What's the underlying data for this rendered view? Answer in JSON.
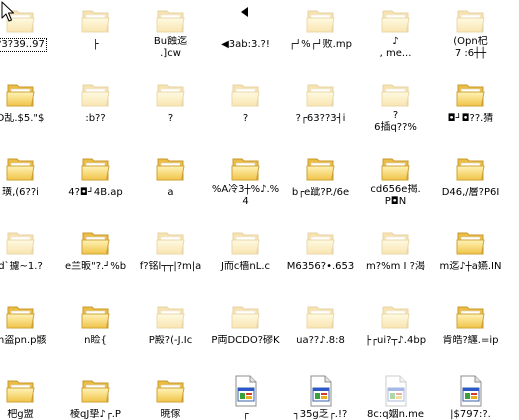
{
  "colors": {
    "background": "#ffffff",
    "label_text": "#000000"
  },
  "cursor": {
    "icon": "arrow-cursor"
  },
  "items": [
    {
      "label": "?3?39..97",
      "icon": "folder",
      "hidden": true,
      "focused": true
    },
    {
      "label": "├",
      "icon": "folder",
      "hidden": true
    },
    {
      "label": "Bu蝕迄\n.]cw",
      "icon": "folder",
      "hidden": true
    },
    {
      "label": "◀3ab:3.?!",
      "icon": "triangle",
      "hidden": false
    },
    {
      "label": "┌┘%┌┘败.mp",
      "icon": "folder",
      "hidden": true
    },
    {
      "label": "♪\n, me...",
      "icon": "folder",
      "hidden": true
    },
    {
      "label": "(Opn杞\n7 :6┼┼",
      "icon": "folder",
      "hidden": true
    },
    {
      "label": "D乱.$5.\"$",
      "icon": "folder",
      "hidden": false
    },
    {
      "label": ":b??",
      "icon": "folder",
      "hidden": true
    },
    {
      "label": "?",
      "icon": "folder",
      "hidden": true
    },
    {
      "label": "?",
      "icon": "folder",
      "hidden": true
    },
    {
      "label": "?┌63??3┤i",
      "icon": "folder",
      "hidden": true
    },
    {
      "label": "?\n6插q??%",
      "icon": "folder",
      "hidden": true
    },
    {
      "label": "◘┘◘??.猜",
      "icon": "folder",
      "hidden": false
    },
    {
      "label": "璜,(6??i",
      "icon": "folder",
      "hidden": false
    },
    {
      "label": "4?◘┘4B.ap",
      "icon": "folder",
      "hidden": false
    },
    {
      "label": "a",
      "icon": "folder",
      "hidden": false
    },
    {
      "label": "%A冷3┼%♪.%4",
      "icon": "folder",
      "hidden": false
    },
    {
      "label": "b┌e跐?P./6e",
      "icon": "folder",
      "hidden": false
    },
    {
      "label": "cd656e揭.\nP◘N",
      "icon": "folder",
      "hidden": false
    },
    {
      "label": "D46,/層?P6I",
      "icon": "folder",
      "hidden": false
    },
    {
      "label": "d`攄~1.?",
      "icon": "folder",
      "hidden": true
    },
    {
      "label": "e兰昄\"?.┘%b",
      "icon": "folder",
      "hidden": false
    },
    {
      "label": "f?铭l┬┬|?m|a",
      "icon": "folder",
      "hidden": true
    },
    {
      "label": "J而c樯nL.c",
      "icon": "folder",
      "hidden": true
    },
    {
      "label": "M6356?•.653",
      "icon": "folder",
      "hidden": true
    },
    {
      "label": "m?%m I ?渴",
      "icon": "folder",
      "hidden": true
    },
    {
      "label": "m迄♪┼a嬿.IN",
      "icon": "folder",
      "hidden": false
    },
    {
      "label": "m盗pn.p骸",
      "icon": "folder",
      "hidden": false
    },
    {
      "label": "n睑{",
      "icon": "folder",
      "hidden": false
    },
    {
      "label": "P殿?(-J.Ic",
      "icon": "folder",
      "hidden": true
    },
    {
      "label": "P両DCDO?磟K",
      "icon": "folder",
      "hidden": true
    },
    {
      "label": "ua??♪.8:8",
      "icon": "folder",
      "hidden": true
    },
    {
      "label": "├┌ui?┬♪.4bp",
      "icon": "folder",
      "hidden": true
    },
    {
      "label": "肯皓?纏.=ip",
      "icon": "folder",
      "hidden": false
    },
    {
      "label": "杷g盟",
      "icon": "folder",
      "hidden": false
    },
    {
      "label": "棱qJ挚♪┌.P",
      "icon": "folder",
      "hidden": false
    },
    {
      "label": "暁傢",
      "icon": "folder",
      "hidden": false
    },
    {
      "label": "┌",
      "icon": "image-file",
      "hidden": false
    },
    {
      "label": "┐35g乏┌.!?",
      "icon": "image-file",
      "hidden": false
    },
    {
      "label": "8c:q姻n.me",
      "icon": "image-file",
      "hidden": true
    },
    {
      "label": "|$797:?.",
      "icon": "image-file",
      "hidden": false
    }
  ]
}
